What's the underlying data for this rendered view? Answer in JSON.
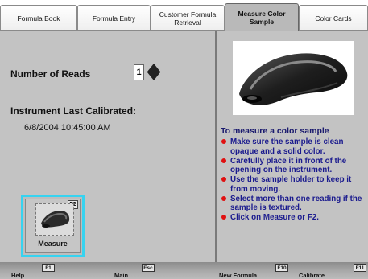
{
  "tabs": [
    {
      "label": "Formula Book"
    },
    {
      "label": "Formula Entry"
    },
    {
      "label_line1": "Customer Formula",
      "label_line2": "Retrieval"
    },
    {
      "label_line1": "Measure Color",
      "label_line2": "Sample",
      "active": true
    },
    {
      "label": "Color Cards"
    }
  ],
  "reads": {
    "label": "Number of Reads",
    "value": "1"
  },
  "calibration": {
    "label": "Instrument Last Calibrated:",
    "value": "6/8/2004  10:45:00 AM"
  },
  "measure_button": {
    "label": "Measure",
    "key": "F2"
  },
  "instructions": {
    "title": "To measure a color sample",
    "items": [
      "Make sure the sample is clean opaque and a solid color.",
      "Carefully place it in front of the opening on the instrument.",
      "Use the sample holder to keep it from moving.",
      "Select more than one reading if the sample is textured.",
      "Click on Measure or F2."
    ]
  },
  "function_keys": [
    {
      "key": "F1",
      "label": "Help"
    },
    {
      "key": "Esc",
      "label": "Main"
    },
    {
      "key": "F10",
      "label": "New Formula"
    },
    {
      "key": "F11",
      "label": "Calibrate"
    }
  ],
  "colors": {
    "selection": "#36d3f0",
    "instruction_text": "#1a1a8e",
    "bullet": "#e01010",
    "panel": "#c3c3c3"
  },
  "icons": [
    "spinner-up-icon",
    "spinner-down-icon",
    "instrument-icon",
    "bullet-icon"
  ]
}
